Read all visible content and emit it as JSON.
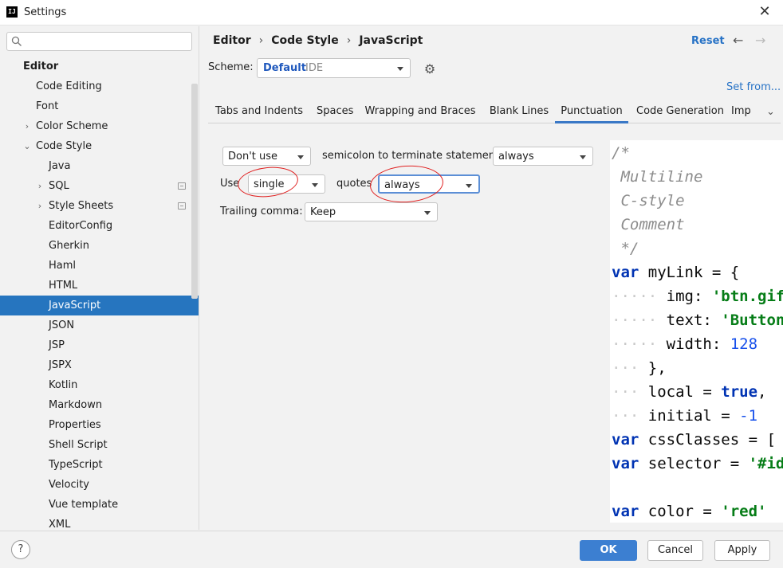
{
  "window": {
    "title": "Settings",
    "logo_text": "IJ",
    "close_glyph": "✕"
  },
  "sidebar": {
    "search": {
      "value": "",
      "placeholder": ""
    },
    "items": [
      {
        "label": "Editor",
        "level": 0,
        "expand": "none",
        "bold": true
      },
      {
        "label": "Code Editing",
        "level": 1,
        "expand": "none"
      },
      {
        "label": "Font",
        "level": 1,
        "expand": "none"
      },
      {
        "label": "Color Scheme",
        "level": 1,
        "expand": "collapsed"
      },
      {
        "label": "Code Style",
        "level": 1,
        "expand": "expanded"
      },
      {
        "label": "Java",
        "level": 2,
        "expand": "none"
      },
      {
        "label": "SQL",
        "level": 2,
        "expand": "collapsed",
        "badge": true
      },
      {
        "label": "Style Sheets",
        "level": 2,
        "expand": "collapsed",
        "badge": true
      },
      {
        "label": "EditorConfig",
        "level": 2,
        "expand": "none"
      },
      {
        "label": "Gherkin",
        "level": 2,
        "expand": "none"
      },
      {
        "label": "Haml",
        "level": 2,
        "expand": "none"
      },
      {
        "label": "HTML",
        "level": 2,
        "expand": "none"
      },
      {
        "label": "JavaScript",
        "level": 2,
        "expand": "none",
        "selected": true
      },
      {
        "label": "JSON",
        "level": 2,
        "expand": "none"
      },
      {
        "label": "JSP",
        "level": 2,
        "expand": "none"
      },
      {
        "label": "JSPX",
        "level": 2,
        "expand": "none"
      },
      {
        "label": "Kotlin",
        "level": 2,
        "expand": "none"
      },
      {
        "label": "Markdown",
        "level": 2,
        "expand": "none"
      },
      {
        "label": "Properties",
        "level": 2,
        "expand": "none"
      },
      {
        "label": "Shell Script",
        "level": 2,
        "expand": "none"
      },
      {
        "label": "TypeScript",
        "level": 2,
        "expand": "none"
      },
      {
        "label": "Velocity",
        "level": 2,
        "expand": "none"
      },
      {
        "label": "Vue template",
        "level": 2,
        "expand": "none"
      },
      {
        "label": "XML",
        "level": 2,
        "expand": "none"
      }
    ]
  },
  "header": {
    "breadcrumb": [
      "Editor",
      "Code Style",
      "JavaScript"
    ],
    "breadcrumb_sep": "›",
    "reset": "Reset",
    "back_glyph": "←",
    "forward_glyph": "→"
  },
  "scheme": {
    "label": "Scheme:",
    "name": "Default",
    "kind": "IDE",
    "settings_glyph": "⚙",
    "set_from": "Set from..."
  },
  "tabs": {
    "items": [
      "Tabs and Indents",
      "Spaces",
      "Wrapping and Braces",
      "Blank Lines",
      "Punctuation",
      "Code Generation",
      "Imp"
    ],
    "active": "Punctuation",
    "more_glyph": "⌄"
  },
  "punctuation": {
    "semicolon_mode": "Don't use",
    "semicolon_text": "semicolon to terminate statements",
    "semicolon_when": "always",
    "use_label": "Use",
    "quote_type": "single",
    "quotes_label": "quotes",
    "quotes_when": "always",
    "trailing_label": "Trailing comma:",
    "trailing_value": "Keep"
  },
  "preview": {
    "lines": [
      [
        {
          "t": "/*",
          "c": "cmt"
        }
      ],
      [
        {
          "t": " Multiline",
          "c": "cmt"
        }
      ],
      [
        {
          "t": " C-style",
          "c": "cmt"
        }
      ],
      [
        {
          "t": " Comment",
          "c": "cmt"
        }
      ],
      [
        {
          "t": " */",
          "c": "cmt"
        }
      ],
      [
        {
          "t": "var",
          "c": "kw"
        },
        {
          "t": " myLink = {",
          "c": "plain"
        }
      ],
      [
        {
          "t": "·····",
          "c": "dot"
        },
        {
          "t": " img: ",
          "c": "plain"
        },
        {
          "t": "'btn.gif'",
          "c": "str"
        }
      ],
      [
        {
          "t": "·····",
          "c": "dot"
        },
        {
          "t": " text: ",
          "c": "plain"
        },
        {
          "t": "'Button'",
          "c": "str"
        }
      ],
      [
        {
          "t": "·····",
          "c": "dot"
        },
        {
          "t": " width: ",
          "c": "plain"
        },
        {
          "t": "128",
          "c": "num"
        }
      ],
      [
        {
          "t": "···",
          "c": "dot"
        },
        {
          "t": " },",
          "c": "plain"
        }
      ],
      [
        {
          "t": "···",
          "c": "dot"
        },
        {
          "t": " local = ",
          "c": "plain"
        },
        {
          "t": "true",
          "c": "kw"
        },
        {
          "t": ",",
          "c": "plain"
        }
      ],
      [
        {
          "t": "···",
          "c": "dot"
        },
        {
          "t": " initial = ",
          "c": "plain"
        },
        {
          "t": "-1",
          "c": "num"
        }
      ],
      [
        {
          "t": "var",
          "c": "kw"
        },
        {
          "t": " cssClasses = [",
          "c": "plain"
        }
      ],
      [
        {
          "t": "var",
          "c": "kw"
        },
        {
          "t": " selector = ",
          "c": "plain"
        },
        {
          "t": "'#id'",
          "c": "str"
        }
      ],
      [
        {
          "t": "",
          "c": "plain"
        }
      ],
      [
        {
          "t": "var",
          "c": "kw"
        },
        {
          "t": " color = ",
          "c": "plain"
        },
        {
          "t": "'red'",
          "c": "str"
        }
      ]
    ]
  },
  "footer": {
    "help": "?",
    "ok": "OK",
    "cancel": "Cancel",
    "apply": "Apply"
  }
}
